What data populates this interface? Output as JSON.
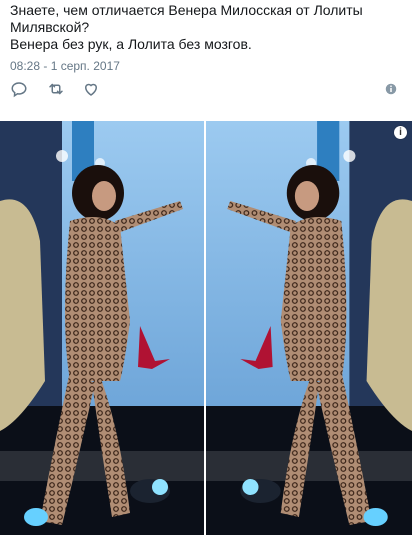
{
  "tweet": {
    "lines": [
      "Знаете, чем отличается Венера Милосская от Лолиты",
      "Милявской?",
      "Венера без рук, а Лолита без мозгов."
    ],
    "timestamp": "08:28 - 1 серп. 2017"
  },
  "actions": {
    "reply_icon": "reply-icon",
    "retweet_icon": "retweet-icon",
    "like_icon": "heart-icon",
    "more_icon": "info-icon"
  },
  "media": {
    "badge": "i",
    "colors": {
      "screen_blue": "#7fb7e8",
      "bird_red": "#b01233",
      "stage_dark": "#0b0f18"
    }
  }
}
